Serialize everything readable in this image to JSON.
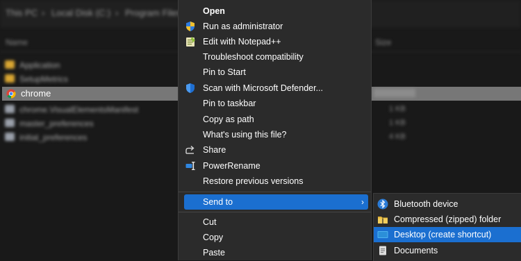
{
  "explorer": {
    "breadcrumb": [
      "This PC",
      "Local Disk (C:)",
      "Program Files"
    ],
    "column_headers": {
      "name": "Name",
      "size": "Size"
    },
    "files": [
      {
        "name": "Application",
        "icon": "folder-icon"
      },
      {
        "name": "SetupMetrics",
        "icon": "folder-icon"
      },
      {
        "name": "chrome",
        "icon": "chrome-icon",
        "selected": true
      },
      {
        "name": "chrome.VisualElementsManifest",
        "icon": "file-icon",
        "size": "1 KB"
      },
      {
        "name": "master_preferences",
        "icon": "file-icon",
        "size": "1 KB"
      },
      {
        "name": "initial_preferences",
        "icon": "file-icon",
        "size": "4 KB"
      }
    ]
  },
  "context_menu": {
    "items": [
      {
        "label": "Open",
        "bold": true,
        "icon": ""
      },
      {
        "label": "Run as administrator",
        "icon": "uac-shield-icon"
      },
      {
        "label": "Edit with Notepad++",
        "icon": "notepad-plus-plus-icon"
      },
      {
        "label": "Troubleshoot compatibility",
        "icon": ""
      },
      {
        "label": "Pin to Start",
        "icon": ""
      },
      {
        "label": "Scan with Microsoft Defender...",
        "icon": "defender-shield-icon"
      },
      {
        "label": "Pin to taskbar",
        "icon": ""
      },
      {
        "label": "Copy as path",
        "icon": ""
      },
      {
        "label": "What's using this file?",
        "icon": ""
      },
      {
        "label": "Share",
        "icon": "share-icon"
      },
      {
        "label": "PowerRename",
        "icon": "powerrename-icon"
      },
      {
        "label": "Restore previous versions",
        "icon": ""
      },
      {
        "label": "Send to",
        "icon": "",
        "highlighted": true,
        "has_submenu": true
      },
      {
        "label": "Cut",
        "icon": ""
      },
      {
        "label": "Copy",
        "icon": ""
      },
      {
        "label": "Paste",
        "icon": ""
      }
    ],
    "submenu_arrow": "›"
  },
  "send_to_submenu": {
    "items": [
      {
        "label": "Bluetooth device",
        "icon": "bluetooth-icon"
      },
      {
        "label": "Compressed (zipped) folder",
        "icon": "zip-folder-icon"
      },
      {
        "label": "Desktop (create shortcut)",
        "icon": "desktop-icon",
        "highlighted": true
      },
      {
        "label": "Documents",
        "icon": "documents-icon"
      }
    ]
  },
  "colors": {
    "menu_bg": "#2b2b2b",
    "highlight": "#1b6fd0",
    "text": "#ffffff",
    "page_bg": "#191919"
  }
}
